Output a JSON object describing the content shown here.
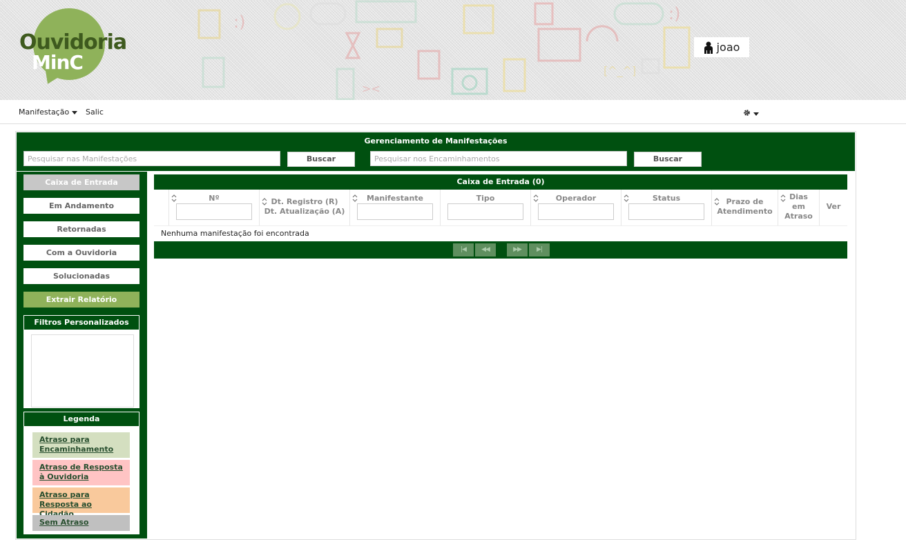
{
  "header": {
    "logo_line1": "Ouvidoria",
    "logo_line2": "MinC",
    "user_name": "joao",
    "user_icon": "user-icon"
  },
  "nav": {
    "items": [
      {
        "label": "Manifestação",
        "has_caret": true
      },
      {
        "label": "Salic",
        "has_caret": false
      }
    ],
    "settings_icon": "gear-icon"
  },
  "main": {
    "title": "Gerenciamento de Manifestações",
    "search_manifestacoes_placeholder": "Pesquisar nas Manifestações",
    "search_encaminhamentos_placeholder": "Pesquisar nos Encaminhamentos",
    "search_button_label": "Buscar"
  },
  "sidebar": {
    "items": [
      {
        "label": "Caixa de Entrada"
      },
      {
        "label": "Em Andamento"
      },
      {
        "label": "Retornadas"
      },
      {
        "label": "Com a Ouvidoria"
      },
      {
        "label": "Solucionadas"
      }
    ],
    "report_label": "Extrair Relatório",
    "filters_title": "Filtros Personalizados",
    "legend_title": "Legenda",
    "legend": [
      {
        "line1": "Atraso para",
        "line2": "Encaminhamento",
        "color": "#d4dfc0"
      },
      {
        "line1": "Atraso de Resposta",
        "line2": "à Ouvidoria",
        "color": "#ffc4c4"
      },
      {
        "line1": "Atraso para",
        "line2": "Resposta ao Cidadão",
        "color": "#f9c99c"
      },
      {
        "line1": "Sem Atraso",
        "line2": "",
        "color": "#c0c0c0"
      }
    ]
  },
  "grid": {
    "title": "Caixa de Entrada (0)",
    "columns": {
      "numero": "Nº",
      "dt_line1": "Dt. Registro (R)",
      "dt_line2": "Dt. Atualização (A)",
      "manifestante": "Manifestante",
      "tipo": "Tipo",
      "operador": "Operador",
      "status": "Status",
      "prazo_line1": "Prazo de",
      "prazo_line2": "Atendimento",
      "dias_line1": "Dias",
      "dias_line2": "em",
      "dias_line3": "Atraso",
      "ver": "Ver"
    },
    "empty_message": "Nenhuma manifestação foi encontrada",
    "pager": {
      "first": "|◀",
      "prev": "◀◀",
      "next": "▶▶",
      "last": "▶|"
    }
  }
}
